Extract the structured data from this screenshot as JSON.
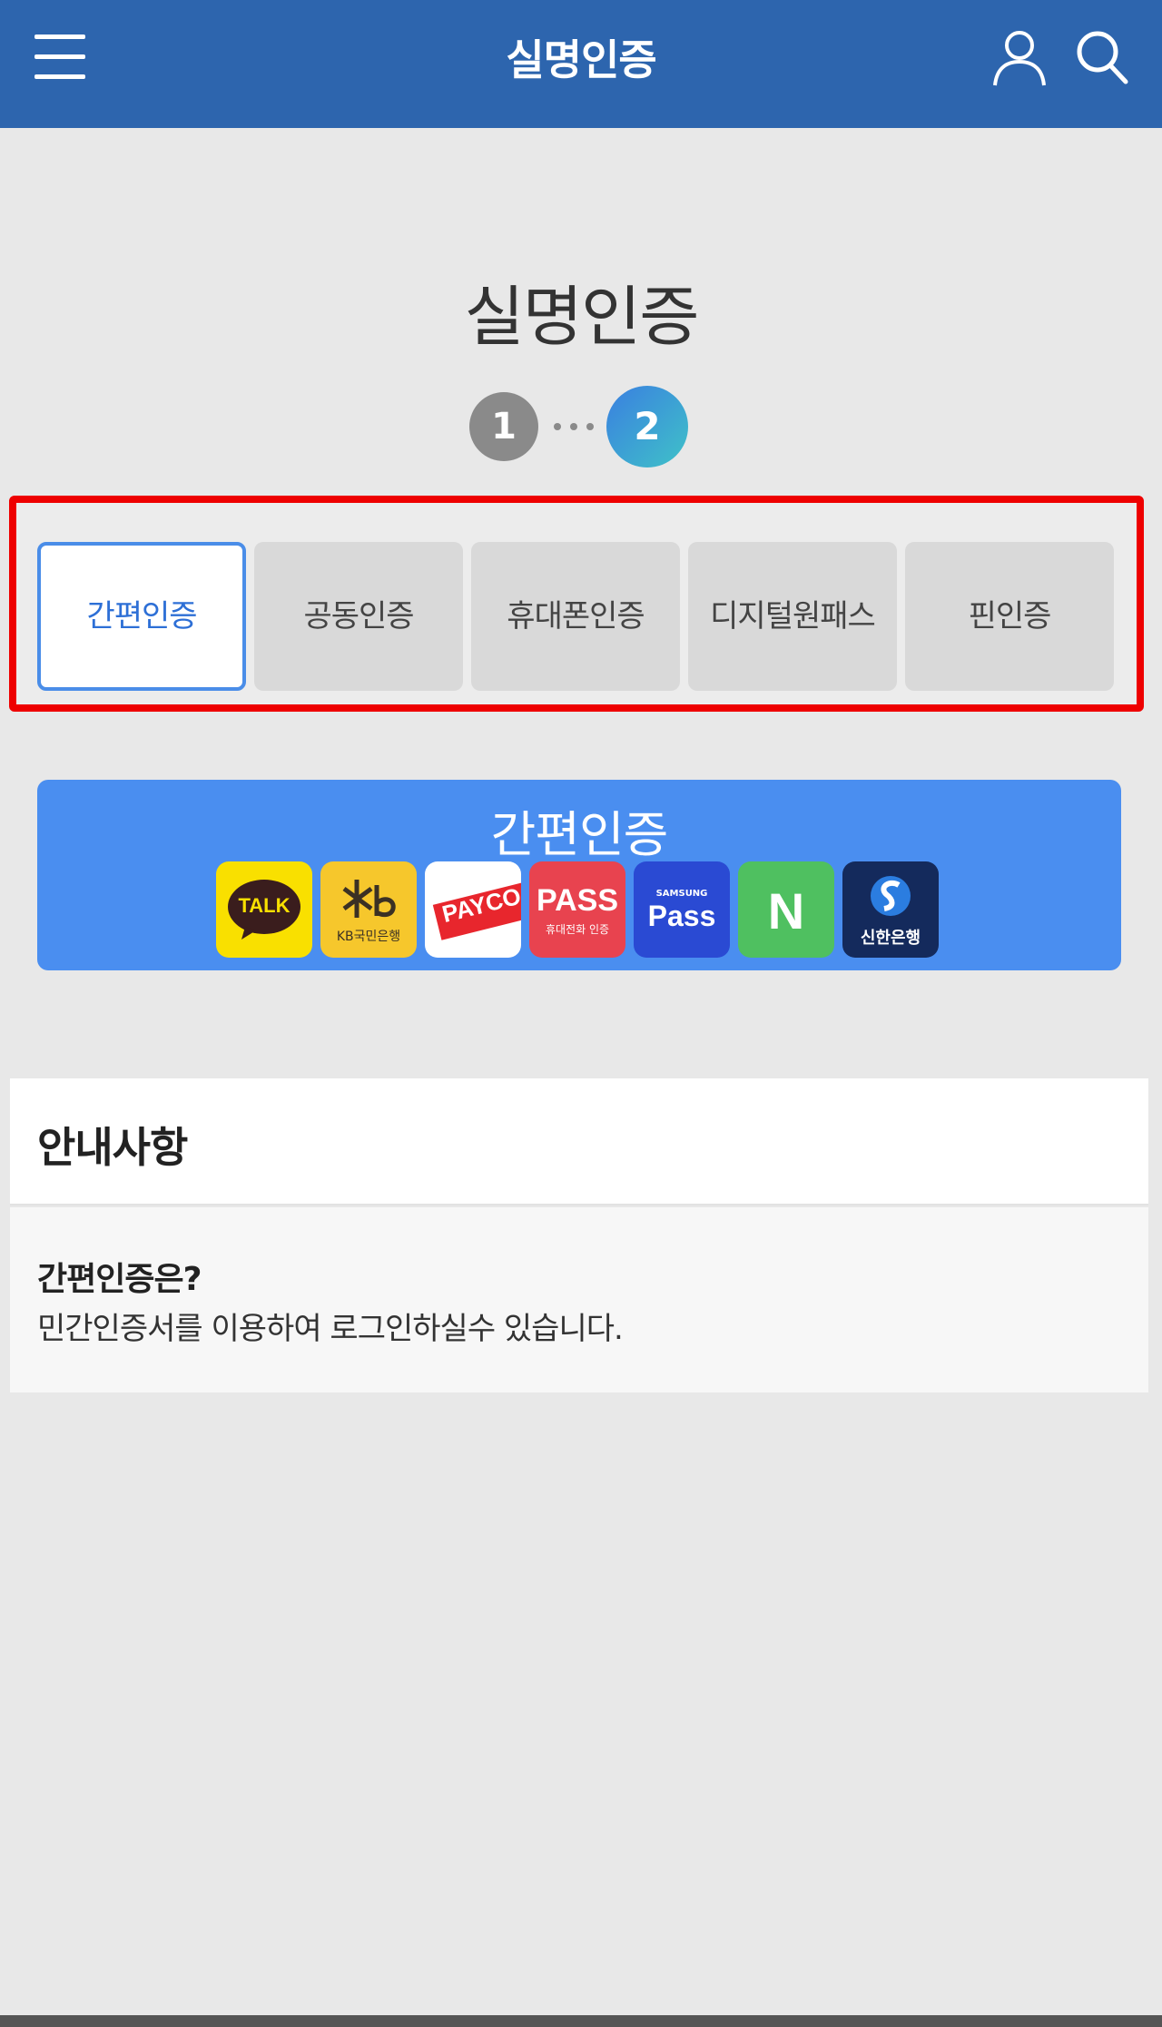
{
  "header": {
    "title": "실명인증"
  },
  "page": {
    "title": "실명인증"
  },
  "stepper": {
    "step1": "1",
    "step2": "2",
    "current": 2
  },
  "tabs": [
    {
      "label": "간편인증",
      "active": true
    },
    {
      "label": "공동인증",
      "active": false
    },
    {
      "label": "휴대폰인증",
      "active": false
    },
    {
      "label": "디지털원패스",
      "active": false
    },
    {
      "label": "핀인증",
      "active": false
    }
  ],
  "banner": {
    "title": "간편인증",
    "providers": [
      {
        "icon": "kakaotalk-icon",
        "text": "TALK"
      },
      {
        "icon": "kb-bank-icon",
        "text": "KB국민은행"
      },
      {
        "icon": "payco-icon",
        "text": "PAYCO"
      },
      {
        "icon": "pass-icon",
        "text": "PASS",
        "sub": "휴대전화 인증"
      },
      {
        "icon": "samsung-pass-icon",
        "text": "Pass",
        "sub": "SAMSUNG"
      },
      {
        "icon": "naver-icon",
        "text": "N"
      },
      {
        "icon": "shinhan-bank-icon",
        "text": "신한은행"
      }
    ]
  },
  "notice": {
    "title": "안내사항",
    "question": "간편인증은?",
    "answer": "민간인증서를 이용하여 로그인하실수 있습니다."
  },
  "colors": {
    "header": "#2d65ae",
    "active_tab_border": "#4a8de8",
    "banner": "#4a8ef0",
    "highlight": "#ee0000"
  }
}
